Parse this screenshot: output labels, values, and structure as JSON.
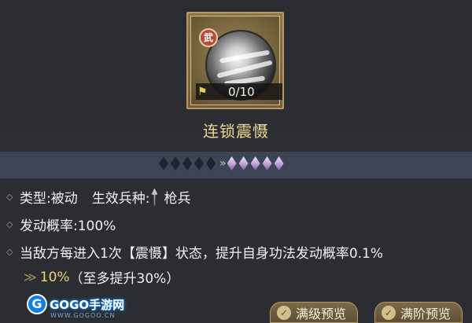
{
  "skill": {
    "name": "连锁震慑",
    "badge": "武",
    "progress": "0/10"
  },
  "stars": {
    "dark_count": 5,
    "light_count": 5,
    "arrow": "»"
  },
  "details": {
    "type_label": "类型:被动",
    "troop_label": "生效兵种:",
    "troop_value": "枪兵",
    "rate_label": "发动概率:100%",
    "description": "当敌方每进入1次【震慑】状态，提升自身功法发动概率0.1%",
    "upgrade_arrow": "≫",
    "upgrade_value": "10%",
    "upgrade_limit": "（至多提升30%）"
  },
  "buttons": {
    "max_level": "满级预览",
    "max_rank": "满阶预览",
    "check_icon": "✓"
  },
  "watermark": {
    "logo": "GOGO手游网",
    "sub": "WWW.GOGOO.CN"
  }
}
